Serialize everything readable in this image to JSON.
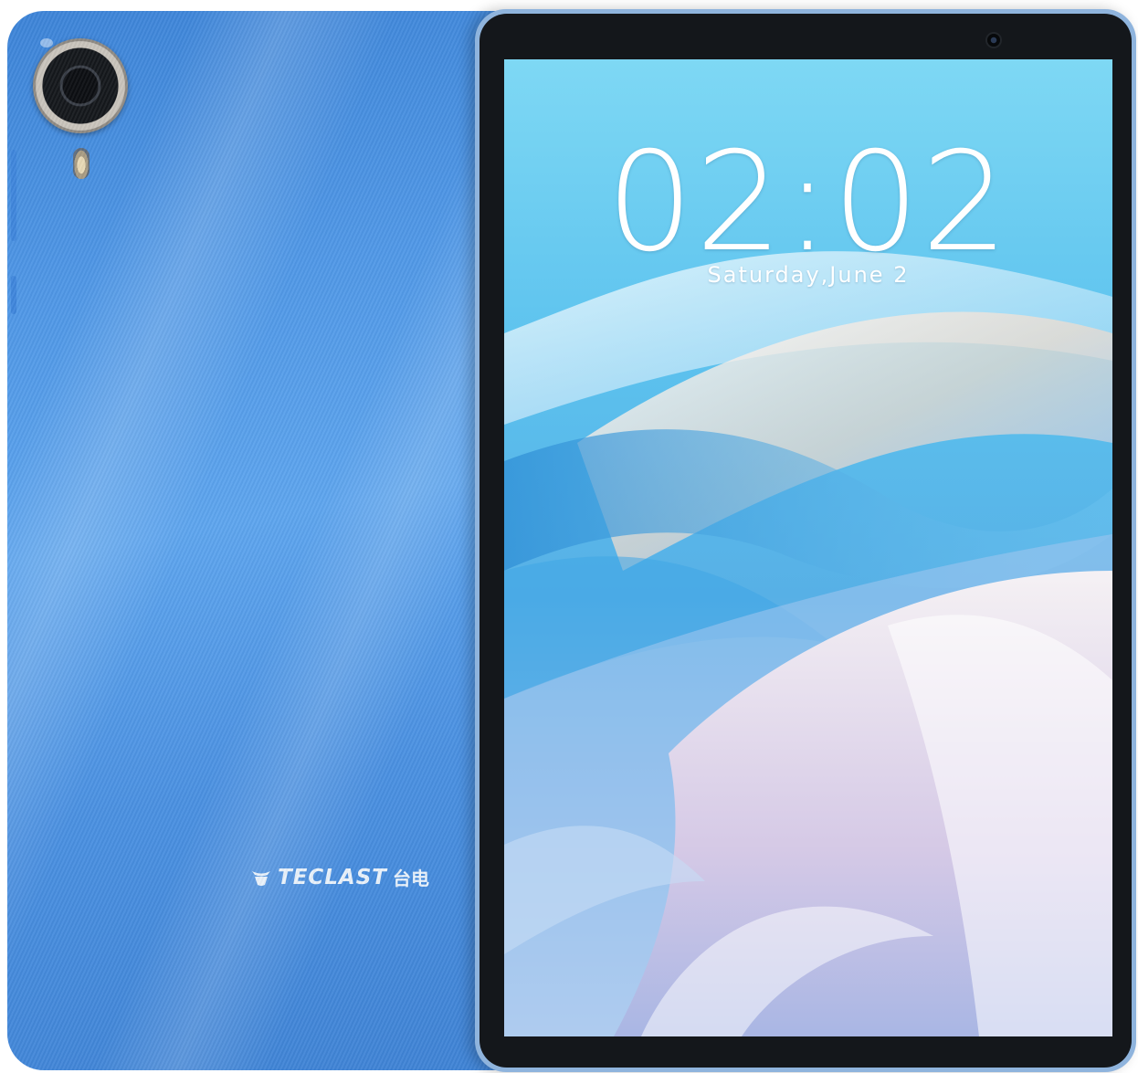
{
  "brand": {
    "logo_text": "TECLAST",
    "logo_cjk": "台电"
  },
  "lock_screen": {
    "time": "02:02",
    "date": "Saturday,June 2"
  },
  "colors": {
    "back_shell": "#4f97e6",
    "frame": "#8fb4dd",
    "bezel": "#14171b",
    "wallpaper_sky": "#5cc2ee"
  }
}
